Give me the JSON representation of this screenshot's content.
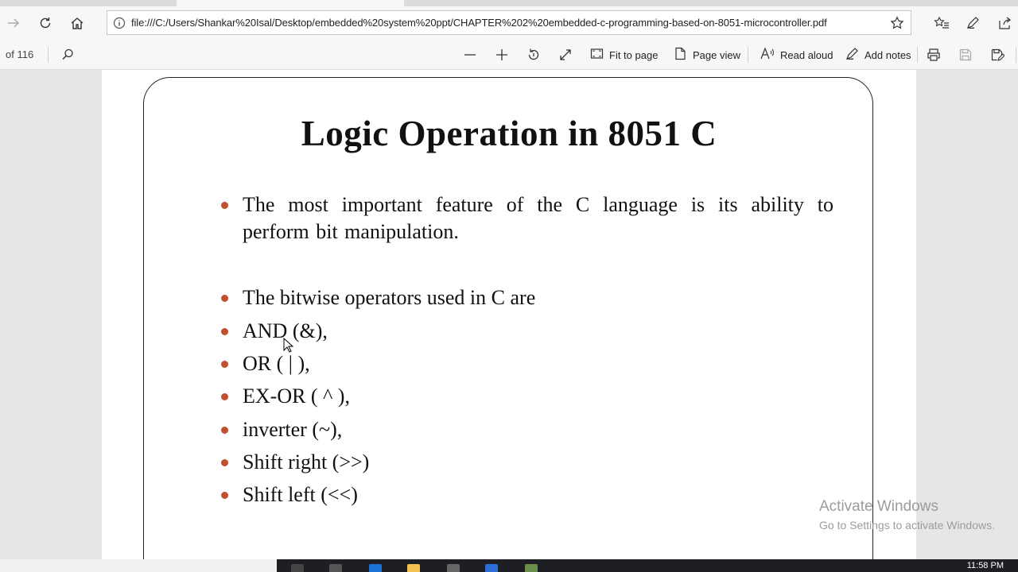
{
  "browser": {
    "url": "file:///C:/Users/Shankar%20Isal/Desktop/embedded%20system%20ppt/CHAPTER%202%20embedded-c-programming-based-on-8051-microcontroller.pdf"
  },
  "pdf_toolbar": {
    "page_count": "of 116",
    "fit_to_page": "Fit to page",
    "page_view": "Page view",
    "read_aloud": "Read aloud",
    "add_notes": "Add notes"
  },
  "slide": {
    "title": "Logic Operation in 8051 C",
    "bullets": [
      "The  most important feature of the C language is its ability to perform bit manipulation.",
      "The bitwise operators used in C are",
      "AND (&),",
      "OR ( | ),",
      "EX-OR ( ^ ),",
      "inverter (~),",
      "Shift right (>>)",
      "Shift left (<<)"
    ],
    "bullet_color": "#c0502f"
  },
  "watermark": {
    "line1": "Activate Windows",
    "line2": "Go to Settings to activate Windows."
  },
  "taskbar": {
    "clock": "11:58 PM"
  }
}
